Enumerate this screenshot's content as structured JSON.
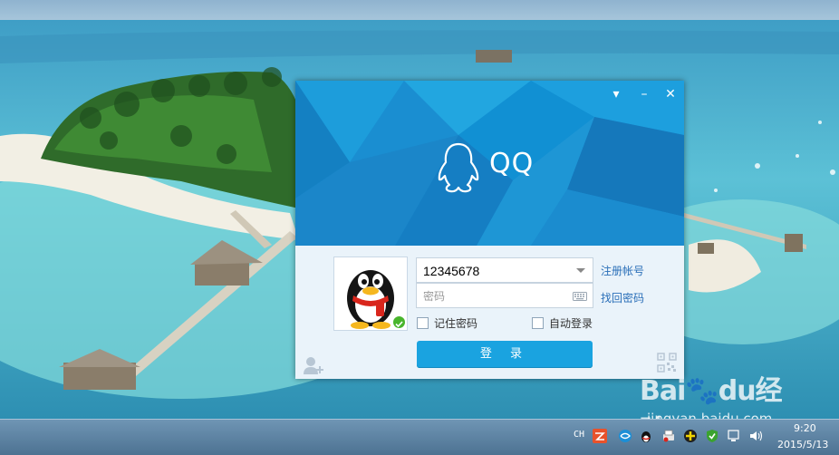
{
  "app": {
    "logo_text": "QQ"
  },
  "login": {
    "account_value": "12345678",
    "password_placeholder": "密码",
    "register_link": "注册帐号",
    "recover_link": "找回密码",
    "remember_password": "记住密码",
    "auto_login": "自动登录",
    "login_button": "登 录"
  },
  "watermark": {
    "main": "Bai🐾du经验",
    "sub": "jingyan.baidu.com"
  },
  "taskbar": {
    "language": "CH",
    "time": "9:20",
    "date": "2015/5/13"
  },
  "icons": {
    "window": [
      "menu-dropdown-icon",
      "minimize-icon",
      "close-icon"
    ],
    "tray": [
      "input-method-icon",
      "network-icon",
      "qq-tray-icon",
      "printer-icon",
      "plus-icon",
      "shield-icon",
      "action-center-icon",
      "volume-icon"
    ]
  },
  "colors": {
    "header_blue": "#1a8ed1",
    "login_button": "#1aa3e0",
    "link": "#2a6fb8",
    "online": "#49b52c"
  }
}
